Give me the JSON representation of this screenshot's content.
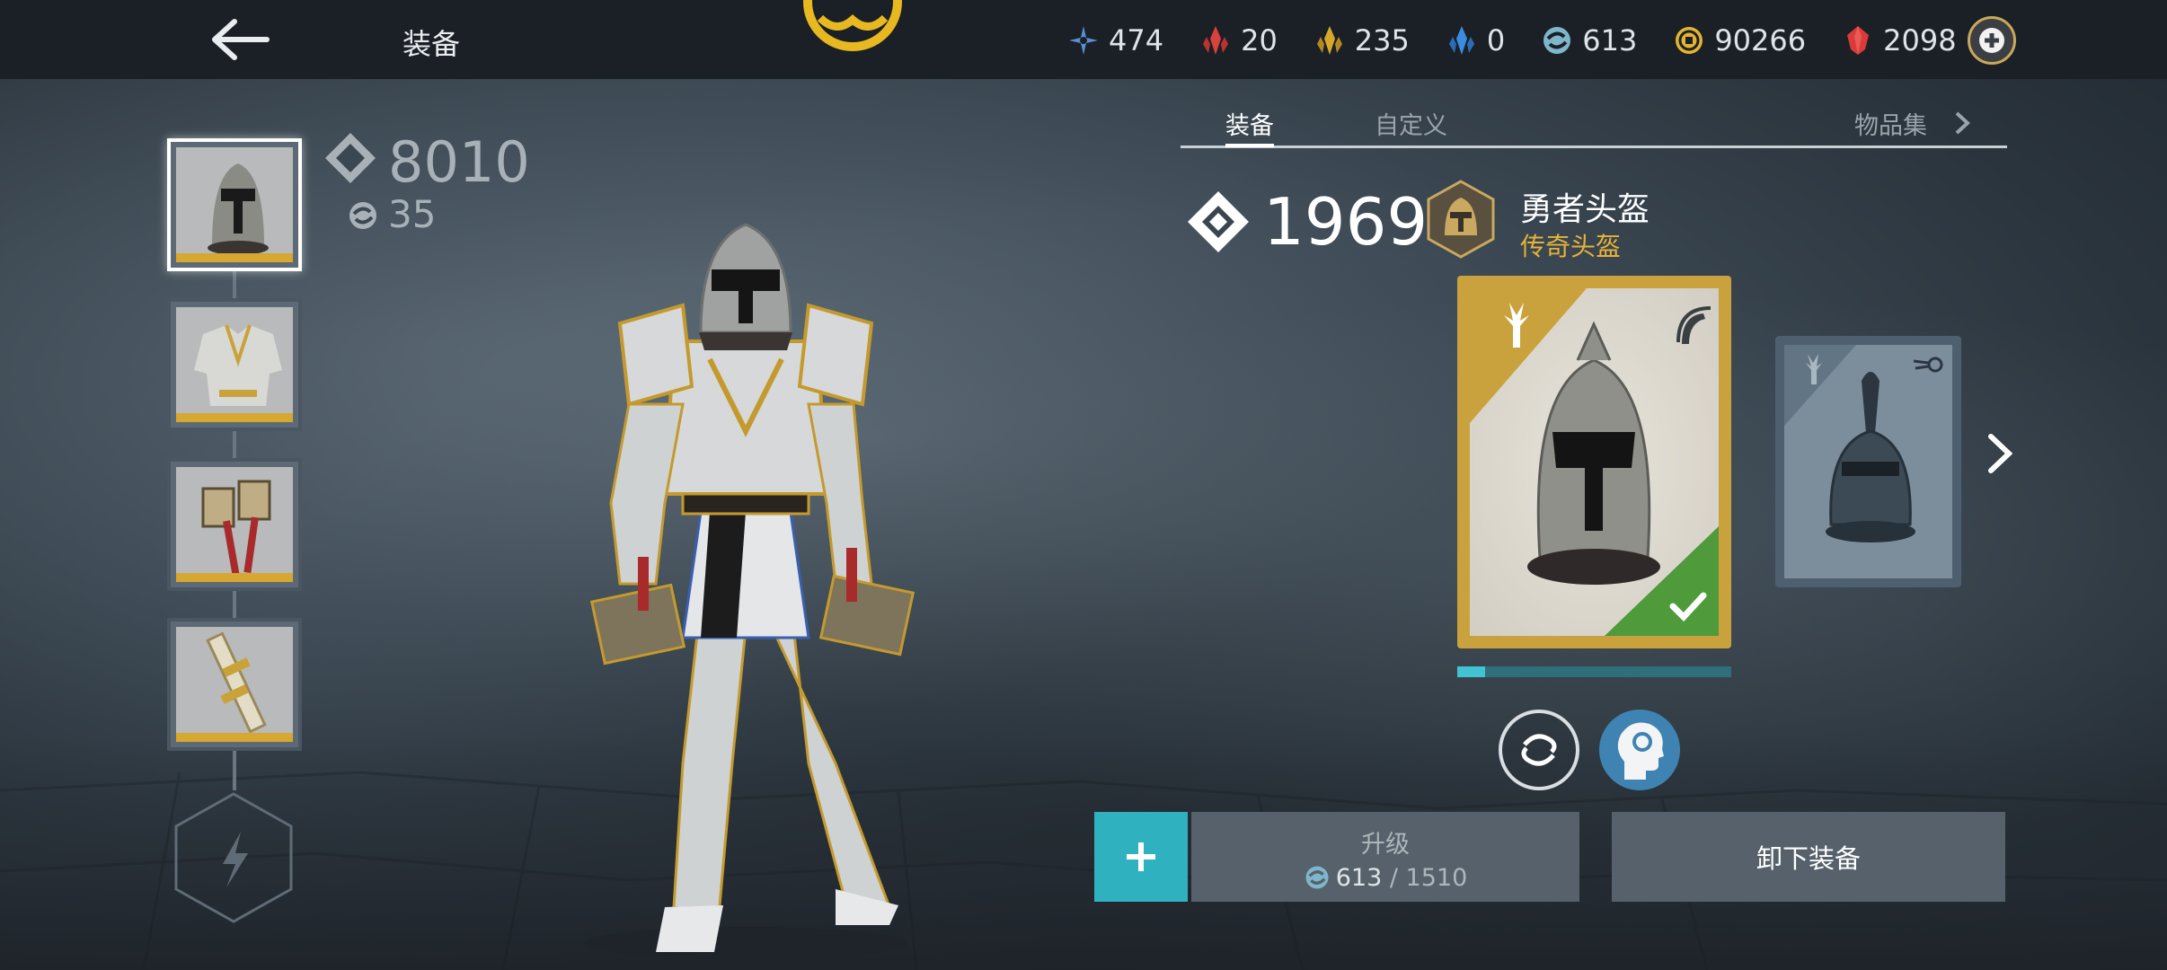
{
  "topbar": {
    "back_icon": "arrow-left-icon",
    "title": "装备",
    "resources": [
      {
        "icon": "blue-sparkle-icon",
        "value": "474",
        "color": "#5a8fd6"
      },
      {
        "icon": "red-crystal-icon",
        "value": "20",
        "color": "#d9423c"
      },
      {
        "icon": "gold-crystal-icon",
        "value": "235",
        "color": "#d8a62a"
      },
      {
        "icon": "blue-crystal-icon",
        "value": "0",
        "color": "#3b8be0"
      },
      {
        "icon": "swirl-icon",
        "value": "613",
        "color": "#7fb6cc"
      },
      {
        "icon": "coin-icon",
        "value": "90266",
        "color": "#e3b431"
      },
      {
        "icon": "ruby-icon",
        "value": "2098",
        "color": "#d93a3a"
      }
    ]
  },
  "left": {
    "power": "8010",
    "swirl_value": "35"
  },
  "tabs": {
    "equip": "装备",
    "customize": "自定义",
    "collection": "物品集"
  },
  "item": {
    "power": "1969",
    "name": "勇者头盔",
    "rarity": "传奇头盔",
    "rarity_color": "#e5b33a",
    "progress": 0.1
  },
  "actions": {
    "upgrade_label": "升级",
    "upgrade_current": "613",
    "upgrade_separator": " / ",
    "upgrade_required": "1510",
    "unequip_label": "卸下装备"
  }
}
